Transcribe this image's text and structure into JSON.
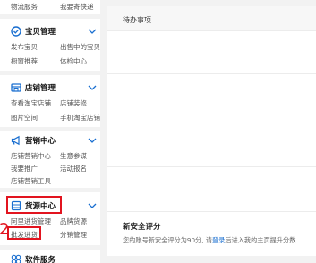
{
  "sidebar": {
    "top_links": [
      "物流服务",
      "我要寄快递"
    ],
    "sections": [
      {
        "title": "宝贝管理",
        "icon": "box-icon",
        "items": [
          "发布宝贝",
          "出售中的宝贝",
          "橱窗推荐",
          "体检中心"
        ]
      },
      {
        "title": "店铺管理",
        "icon": "store-icon",
        "items": [
          "查看淘宝店铺",
          "店铺装修",
          "图片空间",
          "手机淘宝店铺"
        ]
      },
      {
        "title": "营销中心",
        "icon": "megaphone-icon",
        "items": [
          "店铺营销中心",
          "生意参谋",
          "我要推广",
          "活动报名",
          "店铺营销工具"
        ]
      },
      {
        "title": "货源中心",
        "icon": "layers-icon",
        "items": [
          "阿里进货管理",
          "品牌货源",
          "批发进货",
          "分销管理"
        ]
      },
      {
        "title": "软件服务",
        "icon": "apps-icon",
        "items": []
      }
    ],
    "step_marker": "2"
  },
  "main": {
    "todo_title": "待办事项",
    "security": {
      "title": "新安全评分",
      "desc_prefix": "您的账号新安全评分为90分, 请",
      "desc_link": "登录",
      "desc_suffix": "后进入我的主页提升分数"
    }
  },
  "colors": {
    "accent_orange": "#ff6a00",
    "icon_blue": "#1a6fd0",
    "highlight_red": "#e2141f",
    "link_blue": "#1a6fd0"
  }
}
